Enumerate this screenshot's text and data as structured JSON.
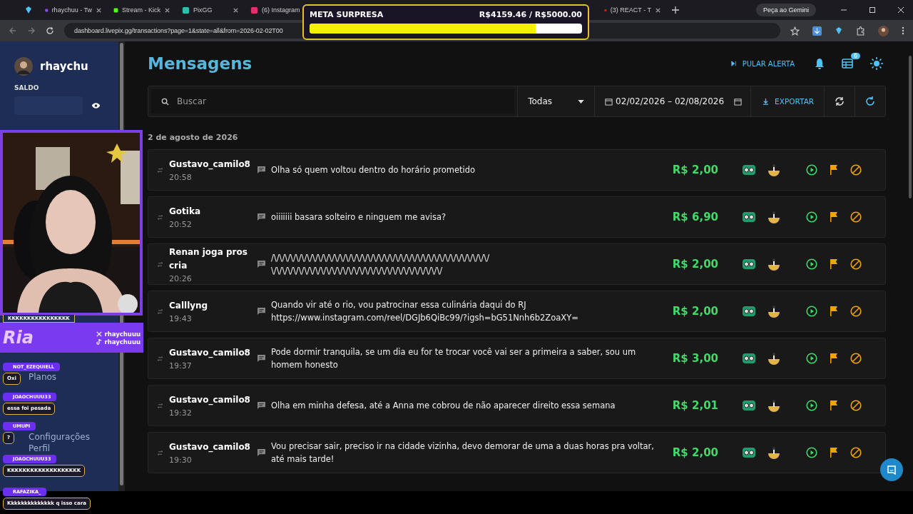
{
  "browser": {
    "tabs": [
      {
        "title": "rhaychuu - Tw",
        "selected": false
      },
      {
        "title": "Stream - Kick",
        "selected": false
      },
      {
        "title": "PixGG",
        "selected": false
      },
      {
        "title": "(6) Instagram",
        "selected": false
      },
      {
        "title": "(3) REACT - T",
        "selected": false
      }
    ],
    "gemini_button": "Peça ao Gemini",
    "url": "dashboard.livepix.gg/transactions?page=1&state=all&from=2026-02-02T00"
  },
  "goal_overlay": {
    "title": "META SURPRESA",
    "amount": "R$4159.46 / R$5000.00",
    "level": 0.83
  },
  "sidebar": {
    "username": "rhaychu",
    "balance_label": "SALDO",
    "menu": [
      "Planos",
      "Configurações",
      "Perfil"
    ]
  },
  "stream_banner": {
    "logo": "Ria",
    "handles": [
      "rhaychuuu",
      "rhaychuuu"
    ]
  },
  "chat_overlay": {
    "partial_message": "KKKKKKKKKKKKKKKK",
    "messages": [
      {
        "user": "NOT_EZEQUIELL",
        "text": "Oxi"
      },
      {
        "user": "JOAOCHUUU33",
        "text": "essa foi pesada"
      },
      {
        "user": "UMUPI",
        "text": "?"
      },
      {
        "user": "JOAOCHUUU33",
        "text": "KKKKKKKKKKKKKKKKKKK"
      },
      {
        "user": "RAFAZIKA_",
        "text": "Kkkkkkkkkkkkkk q isso cara"
      }
    ]
  },
  "page": {
    "title": "Mensagens",
    "skip_alert": "PULAR ALERTA",
    "notifications_badge": "6"
  },
  "filters": {
    "search_placeholder": "Buscar",
    "state": "Todas",
    "date_range": "02/02/2026 – 02/08/2026",
    "export": "EXPORTAR"
  },
  "date_heading": "2 de agosto de 2026",
  "messages": [
    {
      "name": "Gustavo_camilo8",
      "time": "20:58",
      "text": "Olha só quem voltou dentro do horário prometido",
      "amount": "R$ 2,00"
    },
    {
      "name": "Gotika",
      "time": "20:52",
      "text": "oiiiiiii basara solteiro e ninguem me avisa?",
      "amount": "R$ 6,90"
    },
    {
      "name": "Renan joga pros cria",
      "time": "20:26",
      "text": "/\\/\\/\\/\\/\\/\\/\\/\\/\\/\\/\\/\\/\\/\\/\\/\\/\\/\\/\\/\\/\\/\\/\\/\\/\\/\\/\\/\\/\\/\\/\\/\\/\\/\\/\\/\\/\\/\\/\\/ \\/\\/\\/\\/\\/\\/\\/\\/\\/\\/\\/\\/\\/\\/\\/\\/\\/\\/\\/\\/\\/\\/\\/\\/\\/\\/\\/\\/\\/\\/\\/",
      "amount": "R$ 2,00"
    },
    {
      "name": "Calllyng",
      "time": "19:43",
      "text": "Quando vir até o rio, vou patrocinar essa culinária daqui do RJ https://www.instagram.com/reel/DGJb6QiBc99/?igsh=bG51Nnh6b2ZoaXY=",
      "amount": "R$ 2,00"
    },
    {
      "name": "Gustavo_camilo8",
      "time": "19:37",
      "text": "Pode dormir tranquila, se um dia eu for te trocar você vai ser a primeira a saber, sou um homem honesto",
      "amount": "R$ 3,00"
    },
    {
      "name": "Gustavo_camilo8",
      "time": "19:32",
      "text": "Olha em minha defesa, até a Anna me cobrou de não aparecer direito essa semana",
      "amount": "R$ 2,01"
    },
    {
      "name": "Gustavo_camilo8",
      "time": "19:30",
      "text": "Vou precisar sair, preciso ir na cidade vizinha, devo demorar de uma a duas horas pra voltar, até mais tarde!",
      "amount": "R$ 2,00"
    }
  ]
}
